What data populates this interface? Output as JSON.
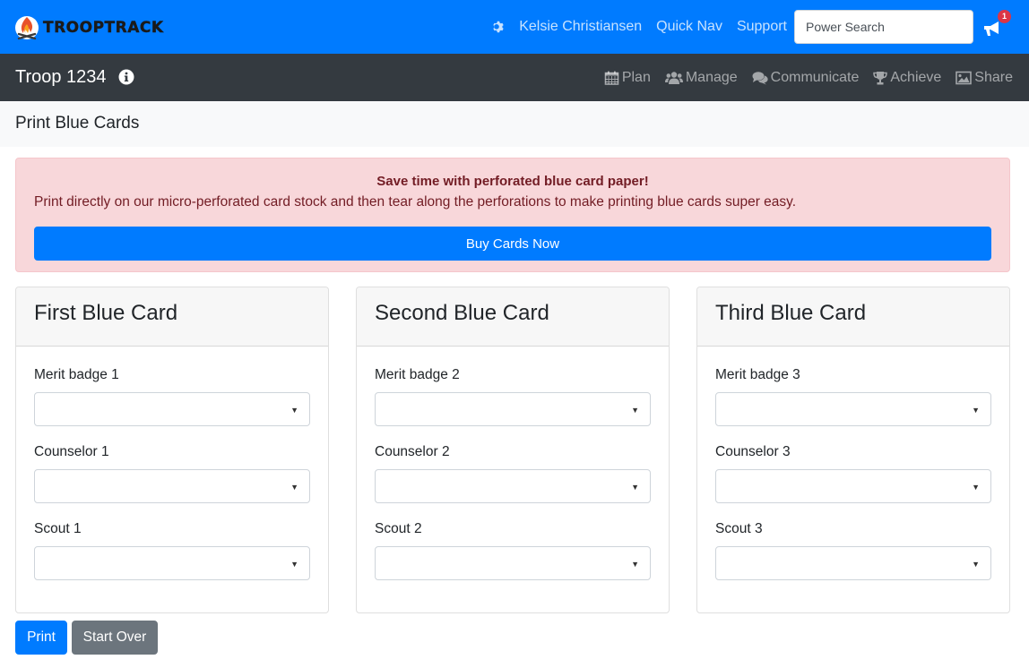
{
  "brand": {
    "name": "TROOPTRACK"
  },
  "topnav": {
    "user_name": "Kelsie Christiansen",
    "quick_nav": "Quick Nav",
    "support": "Support",
    "search_placeholder": "Power Search",
    "notification_count": "1"
  },
  "troopbar": {
    "title": "Troop 1234",
    "menu": [
      {
        "label": "Plan",
        "icon": "calendar-icon"
      },
      {
        "label": "Manage",
        "icon": "users-icon"
      },
      {
        "label": "Communicate",
        "icon": "comments-icon"
      },
      {
        "label": "Achieve",
        "icon": "trophy-icon"
      },
      {
        "label": "Share",
        "icon": "image-icon"
      }
    ]
  },
  "page": {
    "title": "Print Blue Cards"
  },
  "promo": {
    "title": "Save time with perforated blue card paper!",
    "text": "Print directly on our micro-perforated card stock and then tear along the perforations to make printing blue cards super easy.",
    "button": "Buy Cards Now"
  },
  "cards": [
    {
      "title": "First Blue Card",
      "merit_label": "Merit badge 1",
      "counselor_label": "Counselor 1",
      "scout_label": "Scout 1"
    },
    {
      "title": "Second Blue Card",
      "merit_label": "Merit badge 2",
      "counselor_label": "Counselor 2",
      "scout_label": "Scout 2"
    },
    {
      "title": "Third Blue Card",
      "merit_label": "Merit badge 3",
      "counselor_label": "Counselor 3",
      "scout_label": "Scout 3"
    }
  ],
  "actions": {
    "print": "Print",
    "start_over": "Start Over"
  },
  "colors": {
    "primary": "#007bff",
    "dark": "#343a40",
    "alert_bg": "#f8d7da",
    "alert_text": "#721c24",
    "secondary": "#6c757d",
    "badge": "#dc3545"
  }
}
